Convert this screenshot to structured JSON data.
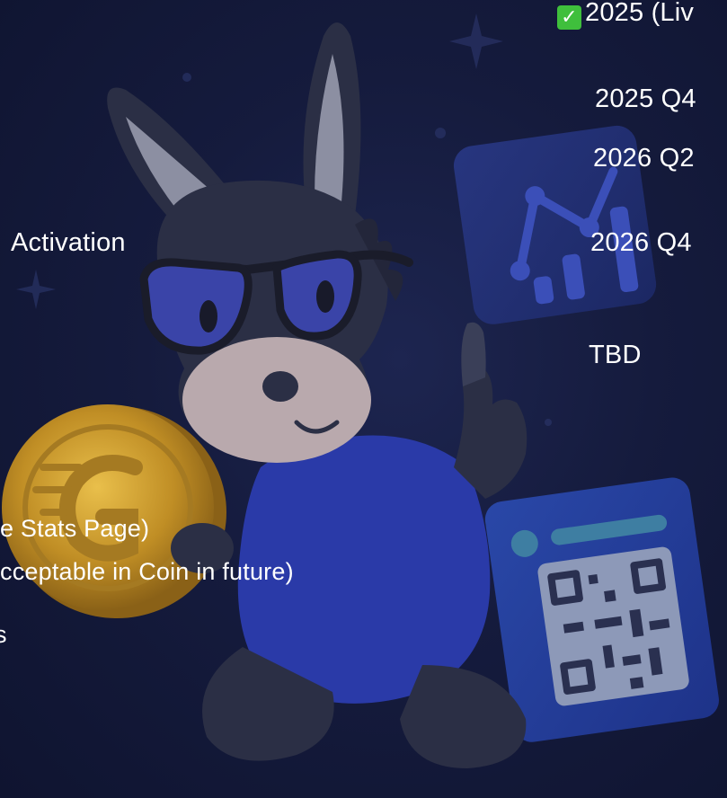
{
  "roadmap_labels": {
    "activation": "Activation",
    "stats_page": "e Stats Page)",
    "acceptable": "cceptable in Coin in future)",
    "cut_s": "s"
  },
  "timeline": {
    "live_check": "✓",
    "live": "2025 (Liv",
    "q4_2025": "2025 Q4",
    "q2_2026": "2026 Q2",
    "q4_2026": "2026 Q4",
    "tbd": "TBD"
  },
  "colors": {
    "background": "#151b3d",
    "text": "#ffffff",
    "check": "#3fbf3c",
    "shirt": "#2a3aa8",
    "coin": "#c99a2e"
  },
  "icons": [
    "chart-card-icon",
    "qr-card-icon",
    "coin-icon",
    "donkey-mascot-illustration"
  ]
}
